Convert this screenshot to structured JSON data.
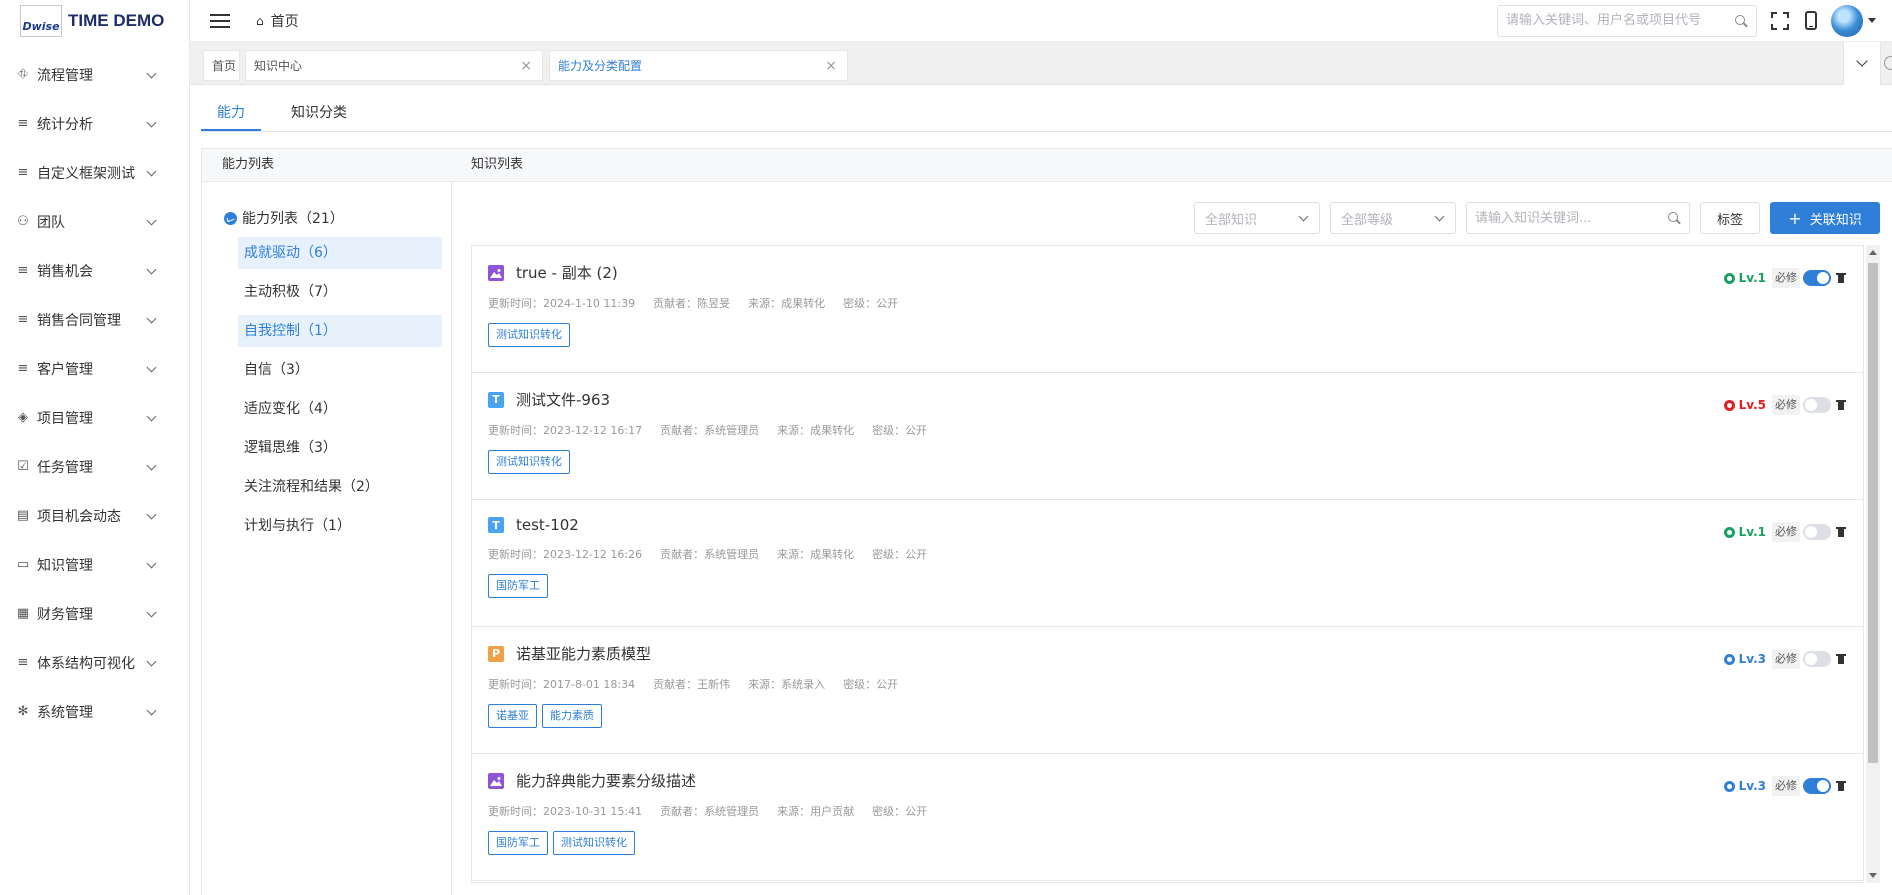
{
  "brand": {
    "logo_text": "Dwise",
    "app_name": "TIME DEMO"
  },
  "sidebar": {
    "items": [
      {
        "label": "流程管理",
        "icon": "⛗"
      },
      {
        "label": "统计分析",
        "icon": "≡"
      },
      {
        "label": "自定义框架测试",
        "icon": "≡"
      },
      {
        "label": "团队",
        "icon": "⚇"
      },
      {
        "label": "销售机会",
        "icon": "≡"
      },
      {
        "label": "销售合同管理",
        "icon": "≡"
      },
      {
        "label": "客户管理",
        "icon": "≡"
      },
      {
        "label": "项目管理",
        "icon": "◈"
      },
      {
        "label": "任务管理",
        "icon": "☑"
      },
      {
        "label": "项目机会动态",
        "icon": "▤"
      },
      {
        "label": "知识管理",
        "icon": "▭"
      },
      {
        "label": "财务管理",
        "icon": "▦"
      },
      {
        "label": "体系结构可视化",
        "icon": "≡"
      },
      {
        "label": "系统管理",
        "icon": "✻"
      }
    ]
  },
  "header": {
    "breadcrumb_home": "首页",
    "search_placeholder": "请输入关键词、用户名或项目代号"
  },
  "page_tabs": [
    {
      "label": "首页",
      "closable": false
    },
    {
      "label": "知识中心",
      "closable": true
    },
    {
      "label": "能力及分类配置",
      "closable": true,
      "active": true
    }
  ],
  "sub_tabs": [
    {
      "label": "能力",
      "active": true
    },
    {
      "label": "知识分类",
      "active": false
    }
  ],
  "left_panel": {
    "title": "能力列表",
    "root_label": "能力列表（21）",
    "items": [
      {
        "label": "成就驱动（6）",
        "highlight": true
      },
      {
        "label": "主动积极（7）",
        "highlight": false
      },
      {
        "label": "自我控制（1）",
        "highlight": true
      },
      {
        "label": "自信（3）",
        "highlight": false
      },
      {
        "label": "适应变化（4）",
        "highlight": false
      },
      {
        "label": "逻辑思维（3）",
        "highlight": false
      },
      {
        "label": "关注流程和结果（2）",
        "highlight": false
      },
      {
        "label": "计划与执行（1）",
        "highlight": false
      }
    ]
  },
  "right_panel": {
    "title": "知识列表",
    "filter_all_knowledge": "全部知识",
    "filter_all_levels": "全部等级",
    "keyword_placeholder": "请输入知识关键词...",
    "tag_button": "标签",
    "link_button": "关联知识",
    "required_label": "必修",
    "items": [
      {
        "type_icon": "image-icon",
        "type_letter": "",
        "title": "true - 副本 (2)",
        "updated": "更新时间：2024-1-10 11:39",
        "contributor": "贡献者：陈昱旻",
        "source": "来源：成果转化",
        "secret": "密级：公开",
        "tags": [
          "测试知识转化"
        ],
        "level": "Lv.1",
        "level_color": "#19a15f",
        "required_on": true
      },
      {
        "type_icon": "text-icon",
        "type_letter": "T",
        "title": "测试文件-963",
        "updated": "更新时间：2023-12-12 16:17",
        "contributor": "贡献者：系统管理员",
        "source": "来源：成果转化",
        "secret": "密级：公开",
        "tags": [
          "测试知识转化"
        ],
        "level": "Lv.5",
        "level_color": "#e02020",
        "required_on": false
      },
      {
        "type_icon": "text-icon",
        "type_letter": "T",
        "title": "test-102",
        "updated": "更新时间：2023-12-12 16:26",
        "contributor": "贡献者：系统管理员",
        "source": "来源：成果转化",
        "secret": "密级：公开",
        "tags": [
          "国防军工"
        ],
        "level": "Lv.1",
        "level_color": "#19a15f",
        "required_on": false
      },
      {
        "type_icon": "ppt-icon",
        "type_letter": "P",
        "title": "诺基亚能力素质模型",
        "updated": "更新时间：2017-8-01 18:34",
        "contributor": "贡献者：王新伟",
        "source": "来源：系统录入",
        "secret": "密级：公开",
        "tags": [
          "诺基亚",
          "能力素质"
        ],
        "level": "Lv.3",
        "level_color": "#2f7fd8",
        "required_on": false
      },
      {
        "type_icon": "image-icon",
        "type_letter": "",
        "title": "能力辞典能力要素分级描述",
        "updated": "更新时间：2023-10-31 15:41",
        "contributor": "贡献者：系统管理员",
        "source": "来源：用户贡献",
        "secret": "密级：公开",
        "tags": [
          "国防军工",
          "测试知识转化"
        ],
        "level": "Lv.3",
        "level_color": "#2f7fd8",
        "required_on": true
      }
    ]
  },
  "colors": {
    "primary": "#2f7fd8",
    "highlight_bg": "#e6f1fc"
  }
}
